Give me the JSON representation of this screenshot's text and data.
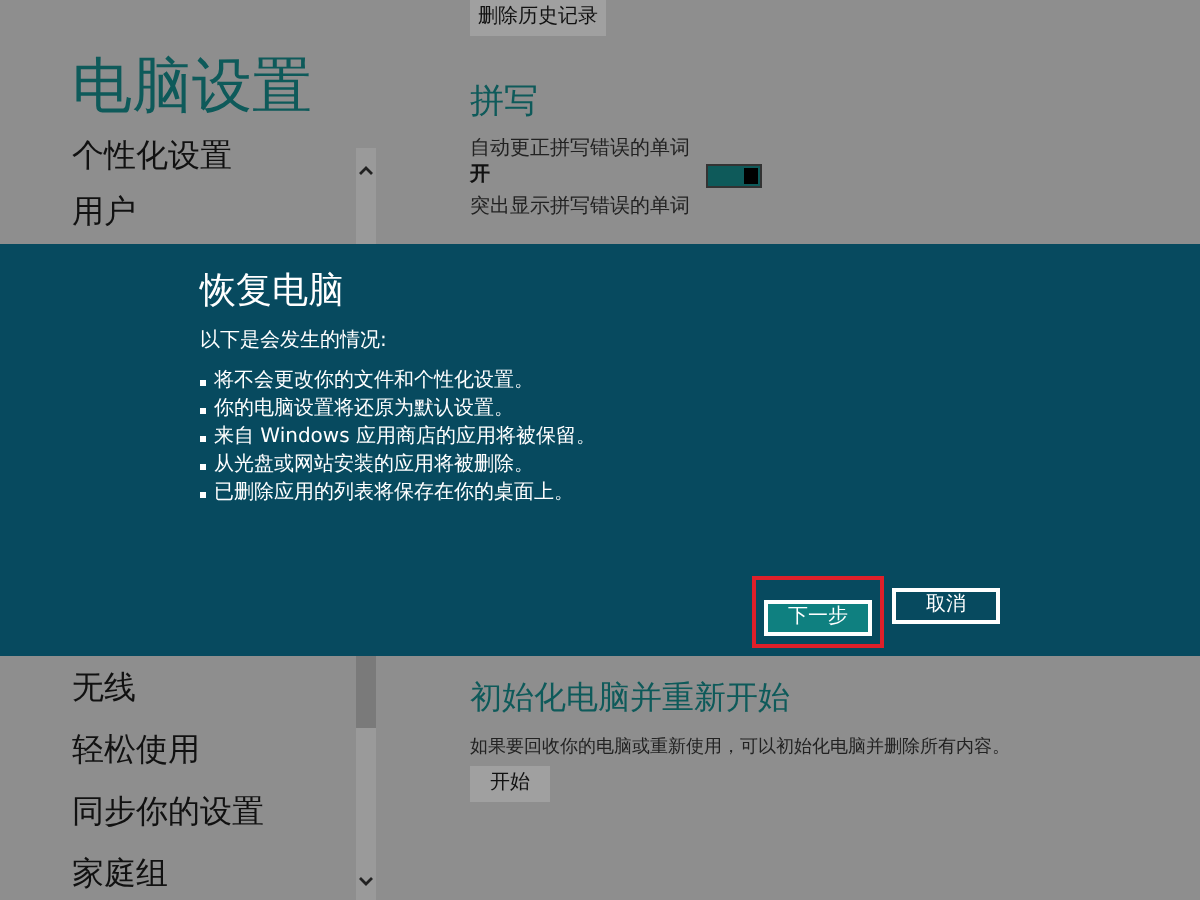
{
  "sidebar": {
    "title": "电脑设置",
    "items_above": [
      "个性化设置",
      "用户"
    ],
    "items_below": [
      "无线",
      "轻松使用",
      "同步你的设置",
      "家庭组"
    ]
  },
  "content_top": {
    "clear_history_button": "删除历史记录",
    "section_title": "拼写",
    "autocorrect": {
      "label": "自动更正拼写错误的单词",
      "state_text": "开",
      "on": true
    },
    "highlight_label": "突出显示拼写错误的单词"
  },
  "dialog": {
    "title": "恢复电脑",
    "intro": "以下是会发生的情况:",
    "bullets": [
      "将不会更改你的文件和个性化设置。",
      "你的电脑设置将还原为默认设置。",
      "来自 Windows 应用商店的应用将被保留。",
      "从光盘或网站安装的应用将被删除。",
      "已删除应用的列表将保存在你的桌面上。"
    ],
    "buttons": [
      {
        "label": "下一步",
        "kind": "primary",
        "highlighted": true
      },
      {
        "label": "取消",
        "kind": "secondary",
        "highlighted": false
      }
    ]
  },
  "content_bottom": {
    "section_title": "初始化电脑并重新开始",
    "description": "如果要回收你的电脑或重新使用，可以初始化电脑并删除所有内容。",
    "start_button": "开始"
  }
}
